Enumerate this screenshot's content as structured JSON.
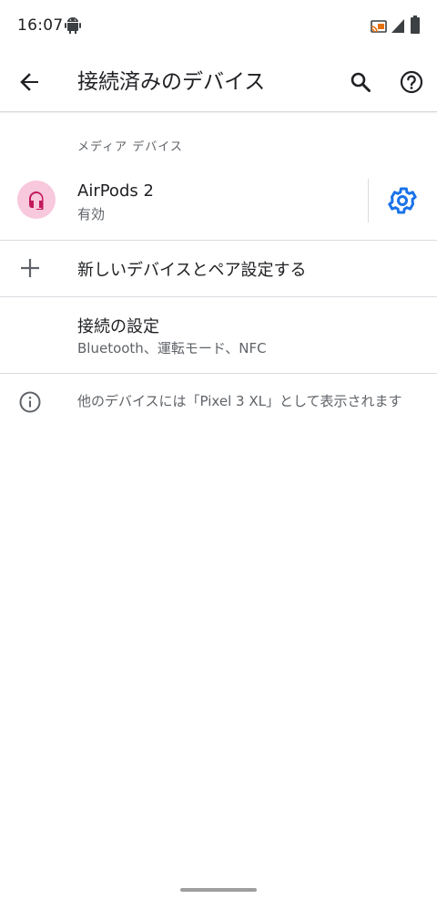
{
  "status_bar": {
    "time": "16:07"
  },
  "app_bar": {
    "title": "接続済みのデバイス"
  },
  "media_section": {
    "header": "メディア デバイス"
  },
  "device": {
    "name": "AirPods 2",
    "status": "有効",
    "avatar_color": "#f8c8dc",
    "icon_color": "#c2185b"
  },
  "pair_new": {
    "label": "新しいデバイスとペア設定する"
  },
  "connection_prefs": {
    "title": "接続の設定",
    "subtitle": "Bluetooth、運転モード、NFC"
  },
  "info": {
    "text": "他のデバイスには「Pixel 3 XL」として表示されます"
  },
  "colors": {
    "accent": "#1a73e8",
    "text_primary": "#202124",
    "text_secondary": "#5f6368",
    "divider": "#dadce0"
  }
}
